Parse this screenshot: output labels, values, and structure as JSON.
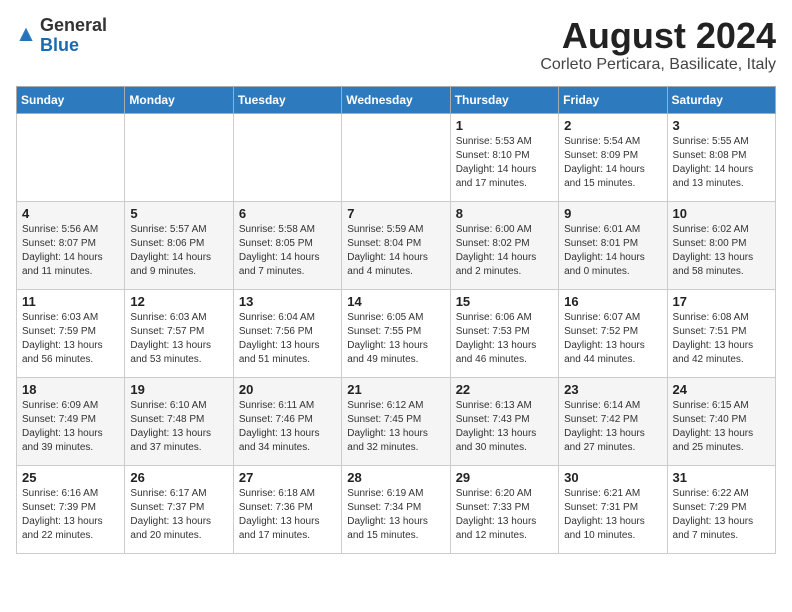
{
  "header": {
    "logo_general": "General",
    "logo_blue": "Blue",
    "month_year": "August 2024",
    "location": "Corleto Perticara, Basilicate, Italy"
  },
  "weekdays": [
    "Sunday",
    "Monday",
    "Tuesday",
    "Wednesday",
    "Thursday",
    "Friday",
    "Saturday"
  ],
  "weeks": [
    [
      {
        "day": "",
        "sunrise": "",
        "sunset": "",
        "daylight": ""
      },
      {
        "day": "",
        "sunrise": "",
        "sunset": "",
        "daylight": ""
      },
      {
        "day": "",
        "sunrise": "",
        "sunset": "",
        "daylight": ""
      },
      {
        "day": "",
        "sunrise": "",
        "sunset": "",
        "daylight": ""
      },
      {
        "day": "1",
        "sunrise": "Sunrise: 5:53 AM",
        "sunset": "Sunset: 8:10 PM",
        "daylight": "Daylight: 14 hours and 17 minutes."
      },
      {
        "day": "2",
        "sunrise": "Sunrise: 5:54 AM",
        "sunset": "Sunset: 8:09 PM",
        "daylight": "Daylight: 14 hours and 15 minutes."
      },
      {
        "day": "3",
        "sunrise": "Sunrise: 5:55 AM",
        "sunset": "Sunset: 8:08 PM",
        "daylight": "Daylight: 14 hours and 13 minutes."
      }
    ],
    [
      {
        "day": "4",
        "sunrise": "Sunrise: 5:56 AM",
        "sunset": "Sunset: 8:07 PM",
        "daylight": "Daylight: 14 hours and 11 minutes."
      },
      {
        "day": "5",
        "sunrise": "Sunrise: 5:57 AM",
        "sunset": "Sunset: 8:06 PM",
        "daylight": "Daylight: 14 hours and 9 minutes."
      },
      {
        "day": "6",
        "sunrise": "Sunrise: 5:58 AM",
        "sunset": "Sunset: 8:05 PM",
        "daylight": "Daylight: 14 hours and 7 minutes."
      },
      {
        "day": "7",
        "sunrise": "Sunrise: 5:59 AM",
        "sunset": "Sunset: 8:04 PM",
        "daylight": "Daylight: 14 hours and 4 minutes."
      },
      {
        "day": "8",
        "sunrise": "Sunrise: 6:00 AM",
        "sunset": "Sunset: 8:02 PM",
        "daylight": "Daylight: 14 hours and 2 minutes."
      },
      {
        "day": "9",
        "sunrise": "Sunrise: 6:01 AM",
        "sunset": "Sunset: 8:01 PM",
        "daylight": "Daylight: 14 hours and 0 minutes."
      },
      {
        "day": "10",
        "sunrise": "Sunrise: 6:02 AM",
        "sunset": "Sunset: 8:00 PM",
        "daylight": "Daylight: 13 hours and 58 minutes."
      }
    ],
    [
      {
        "day": "11",
        "sunrise": "Sunrise: 6:03 AM",
        "sunset": "Sunset: 7:59 PM",
        "daylight": "Daylight: 13 hours and 56 minutes."
      },
      {
        "day": "12",
        "sunrise": "Sunrise: 6:03 AM",
        "sunset": "Sunset: 7:57 PM",
        "daylight": "Daylight: 13 hours and 53 minutes."
      },
      {
        "day": "13",
        "sunrise": "Sunrise: 6:04 AM",
        "sunset": "Sunset: 7:56 PM",
        "daylight": "Daylight: 13 hours and 51 minutes."
      },
      {
        "day": "14",
        "sunrise": "Sunrise: 6:05 AM",
        "sunset": "Sunset: 7:55 PM",
        "daylight": "Daylight: 13 hours and 49 minutes."
      },
      {
        "day": "15",
        "sunrise": "Sunrise: 6:06 AM",
        "sunset": "Sunset: 7:53 PM",
        "daylight": "Daylight: 13 hours and 46 minutes."
      },
      {
        "day": "16",
        "sunrise": "Sunrise: 6:07 AM",
        "sunset": "Sunset: 7:52 PM",
        "daylight": "Daylight: 13 hours and 44 minutes."
      },
      {
        "day": "17",
        "sunrise": "Sunrise: 6:08 AM",
        "sunset": "Sunset: 7:51 PM",
        "daylight": "Daylight: 13 hours and 42 minutes."
      }
    ],
    [
      {
        "day": "18",
        "sunrise": "Sunrise: 6:09 AM",
        "sunset": "Sunset: 7:49 PM",
        "daylight": "Daylight: 13 hours and 39 minutes."
      },
      {
        "day": "19",
        "sunrise": "Sunrise: 6:10 AM",
        "sunset": "Sunset: 7:48 PM",
        "daylight": "Daylight: 13 hours and 37 minutes."
      },
      {
        "day": "20",
        "sunrise": "Sunrise: 6:11 AM",
        "sunset": "Sunset: 7:46 PM",
        "daylight": "Daylight: 13 hours and 34 minutes."
      },
      {
        "day": "21",
        "sunrise": "Sunrise: 6:12 AM",
        "sunset": "Sunset: 7:45 PM",
        "daylight": "Daylight: 13 hours and 32 minutes."
      },
      {
        "day": "22",
        "sunrise": "Sunrise: 6:13 AM",
        "sunset": "Sunset: 7:43 PM",
        "daylight": "Daylight: 13 hours and 30 minutes."
      },
      {
        "day": "23",
        "sunrise": "Sunrise: 6:14 AM",
        "sunset": "Sunset: 7:42 PM",
        "daylight": "Daylight: 13 hours and 27 minutes."
      },
      {
        "day": "24",
        "sunrise": "Sunrise: 6:15 AM",
        "sunset": "Sunset: 7:40 PM",
        "daylight": "Daylight: 13 hours and 25 minutes."
      }
    ],
    [
      {
        "day": "25",
        "sunrise": "Sunrise: 6:16 AM",
        "sunset": "Sunset: 7:39 PM",
        "daylight": "Daylight: 13 hours and 22 minutes."
      },
      {
        "day": "26",
        "sunrise": "Sunrise: 6:17 AM",
        "sunset": "Sunset: 7:37 PM",
        "daylight": "Daylight: 13 hours and 20 minutes."
      },
      {
        "day": "27",
        "sunrise": "Sunrise: 6:18 AM",
        "sunset": "Sunset: 7:36 PM",
        "daylight": "Daylight: 13 hours and 17 minutes."
      },
      {
        "day": "28",
        "sunrise": "Sunrise: 6:19 AM",
        "sunset": "Sunset: 7:34 PM",
        "daylight": "Daylight: 13 hours and 15 minutes."
      },
      {
        "day": "29",
        "sunrise": "Sunrise: 6:20 AM",
        "sunset": "Sunset: 7:33 PM",
        "daylight": "Daylight: 13 hours and 12 minutes."
      },
      {
        "day": "30",
        "sunrise": "Sunrise: 6:21 AM",
        "sunset": "Sunset: 7:31 PM",
        "daylight": "Daylight: 13 hours and 10 minutes."
      },
      {
        "day": "31",
        "sunrise": "Sunrise: 6:22 AM",
        "sunset": "Sunset: 7:29 PM",
        "daylight": "Daylight: 13 hours and 7 minutes."
      }
    ]
  ]
}
